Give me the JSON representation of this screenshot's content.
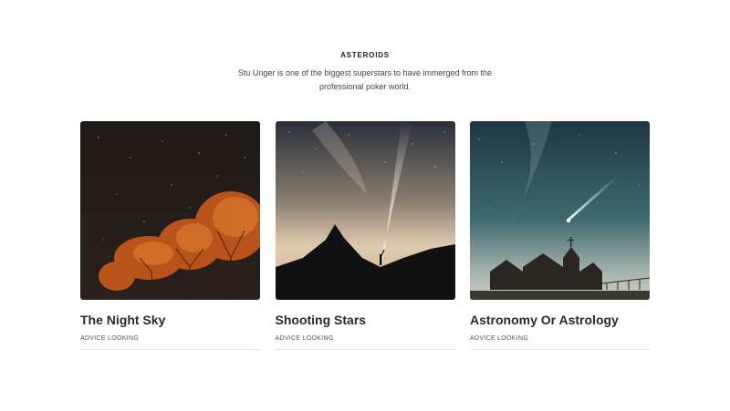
{
  "section": {
    "title": "ASTEROIDS",
    "description": "Stu Unger is one of the biggest superstars to have immerged from the professional poker world."
  },
  "cards": [
    {
      "title": "The Night Sky",
      "meta": "ADVICE LOOKING",
      "image": "night-sky-trees"
    },
    {
      "title": "Shooting Stars",
      "meta": "ADVICE LOOKING",
      "image": "mountain-flashlight"
    },
    {
      "title": "Astronomy Or Astrology",
      "meta": "ADVICE LOOKING",
      "image": "church-comet"
    }
  ]
}
